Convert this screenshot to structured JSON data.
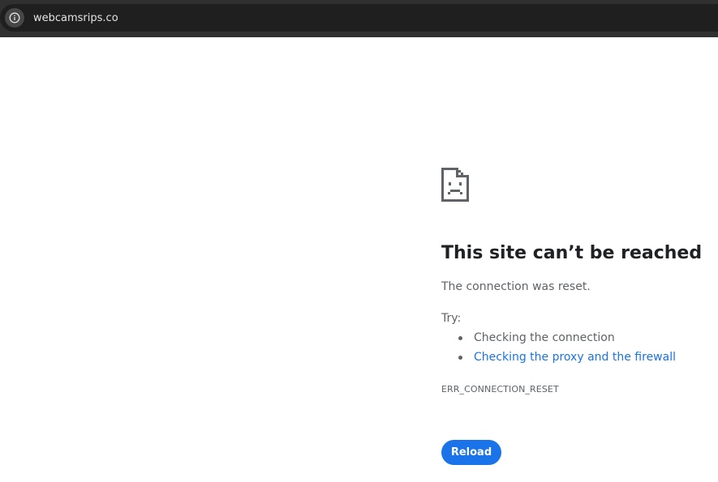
{
  "browser": {
    "url": "webcamsrips.co",
    "site_info_icon": "info-icon"
  },
  "error_page": {
    "icon": "sad-document-icon",
    "title": "This site can’t be reached",
    "message": "The connection was reset.",
    "try_label": "Try:",
    "suggestions": [
      {
        "text": "Checking the connection",
        "is_link": false
      },
      {
        "text": "Checking the proxy and the firewall",
        "is_link": true
      }
    ],
    "error_code": "ERR_CONNECTION_RESET",
    "reload_label": "Reload"
  },
  "colors": {
    "toolbar": "#303030",
    "omnibox": "#1f1f1f",
    "link": "#1a73e8",
    "button": "#1a73e8",
    "title_text": "#202124",
    "body_text": "#5f6368"
  }
}
